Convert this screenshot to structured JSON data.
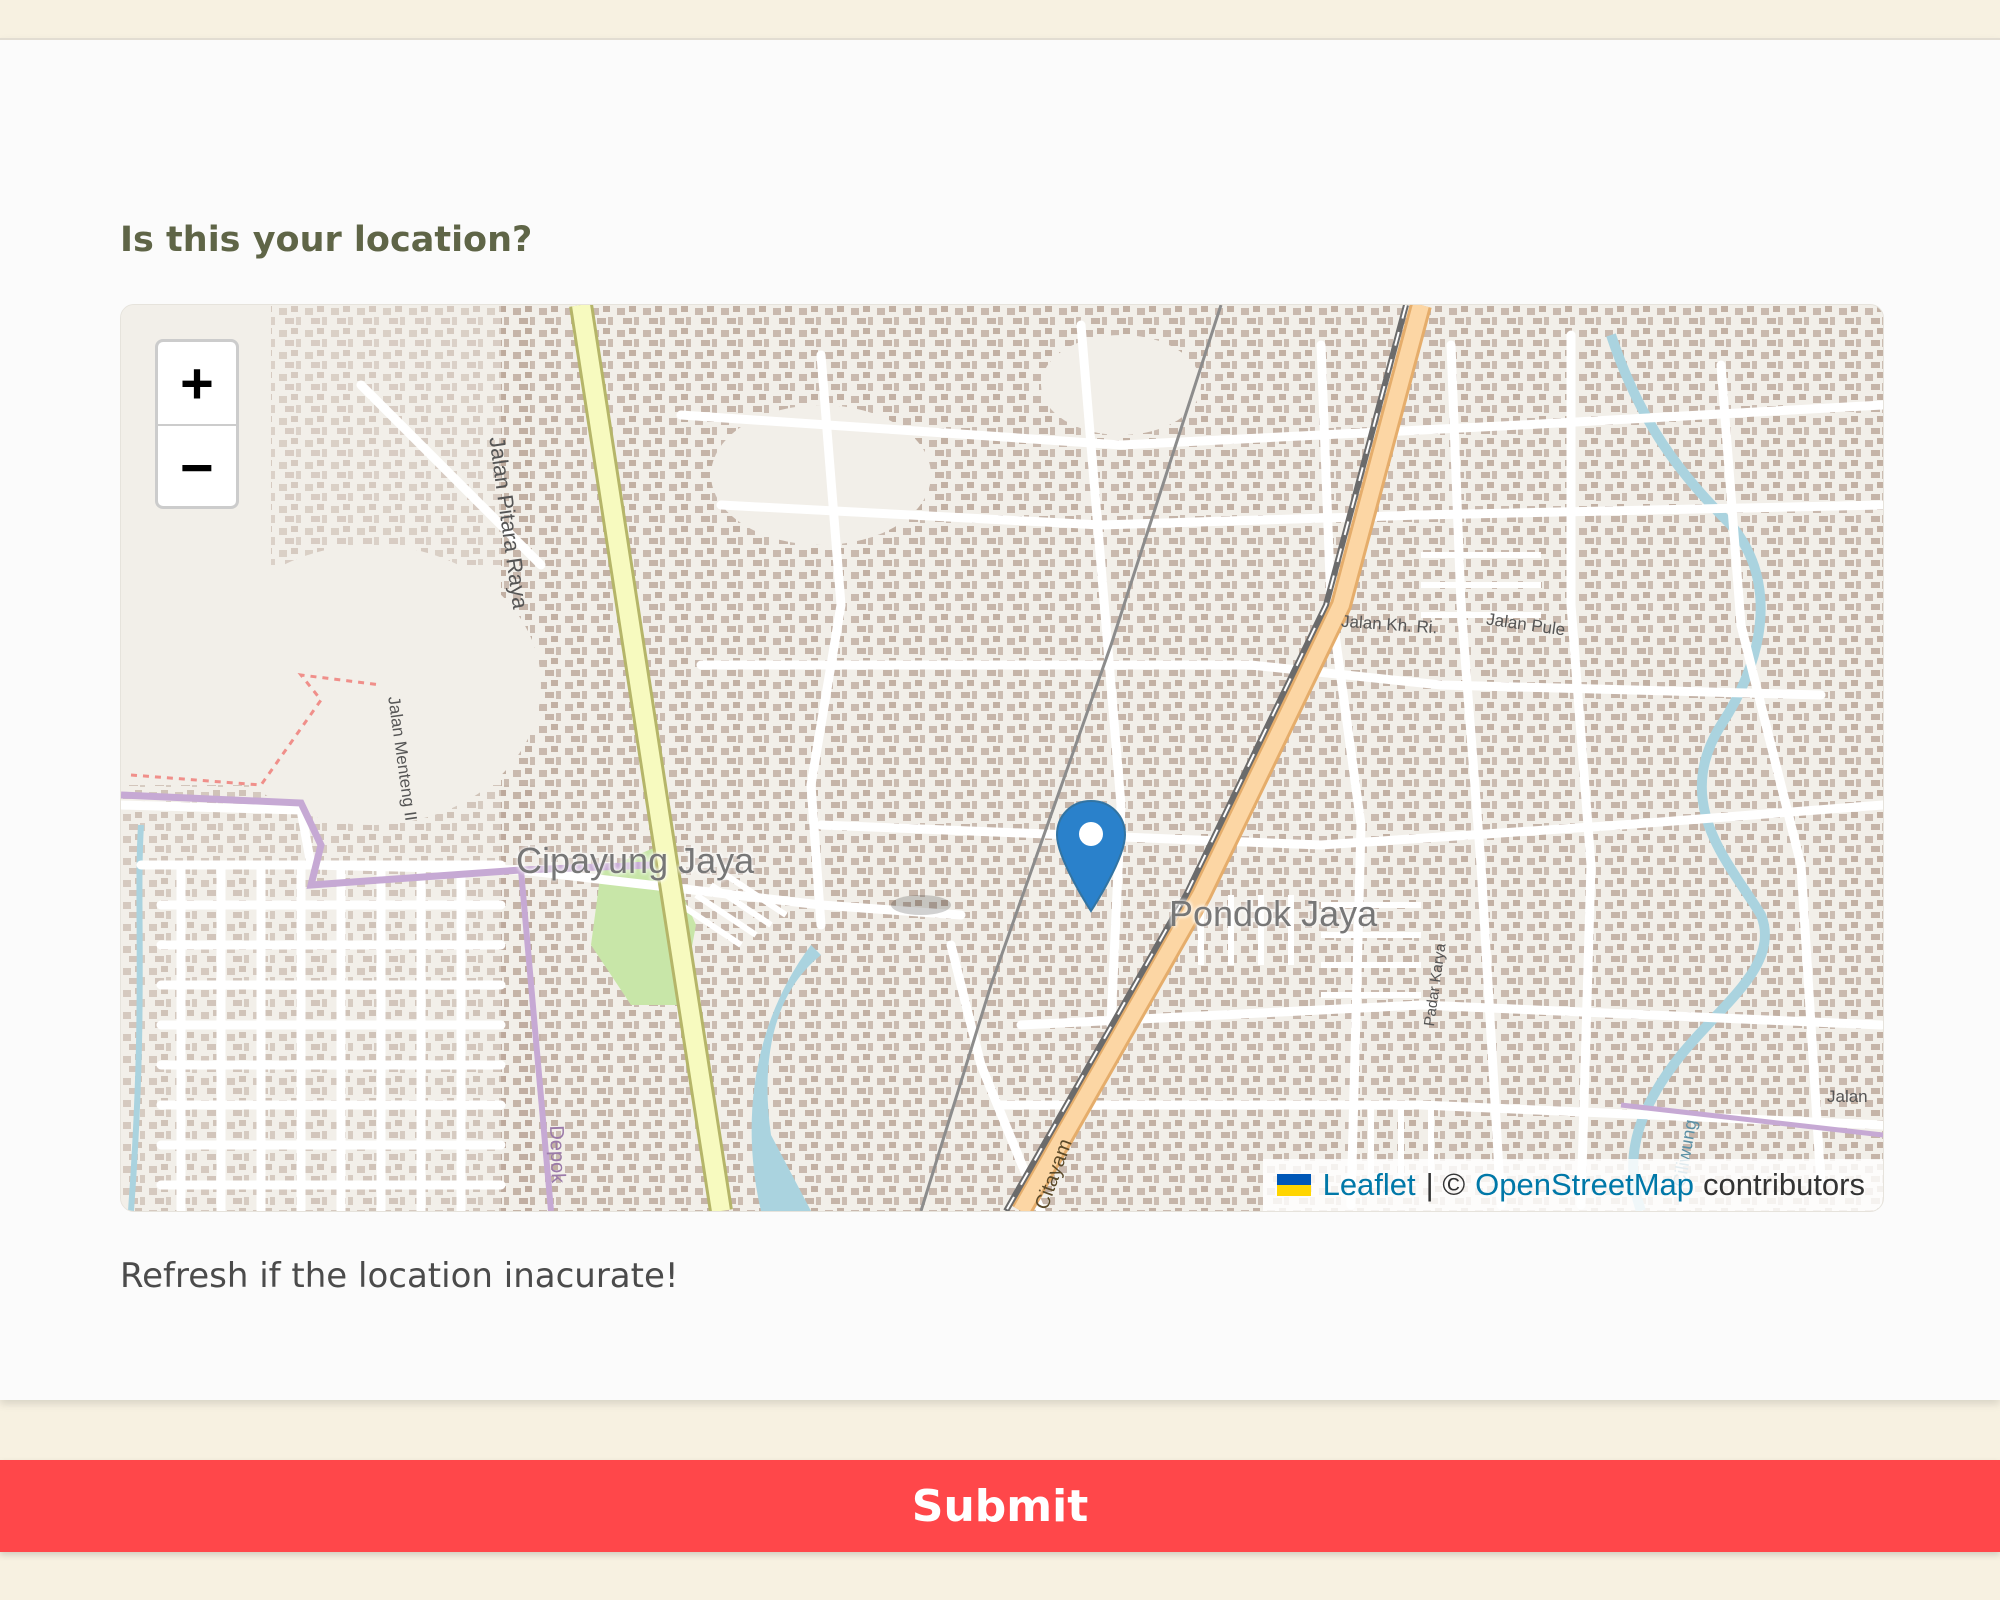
{
  "form": {
    "question": "Is this your location?",
    "hint": "Refresh if the location inacurate!",
    "submit_label": "Submit"
  },
  "map": {
    "zoom_in_label": "+",
    "zoom_out_label": "−",
    "place_labels": {
      "cipayung": "Cipayung Jaya",
      "pondok": "Pondok Jaya",
      "pitara": "Jalan Pitara Raya",
      "menteng": "Jalan Menteng II",
      "kh": "Jalan Kh. Ri.",
      "pule": "Jalan Pule",
      "padar": "Padar Karya",
      "citayam": "Citayam",
      "depok": "Depok",
      "jalan": "Jalan",
      "ciliwung": "Ciliwung"
    },
    "attribution": {
      "leaflet": "Leaflet",
      "separator": "| ©",
      "osm": "OpenStreetMap",
      "contributors": "contributors"
    },
    "colors": {
      "land": "#f2efe9",
      "road": "#ffffff",
      "building": "#b9a597",
      "major_road": "#f7fabf",
      "railway_track": "#fcd6a4",
      "water": "#aad3df",
      "park": "#c8e6a8",
      "marker": "#2a81cb"
    }
  }
}
